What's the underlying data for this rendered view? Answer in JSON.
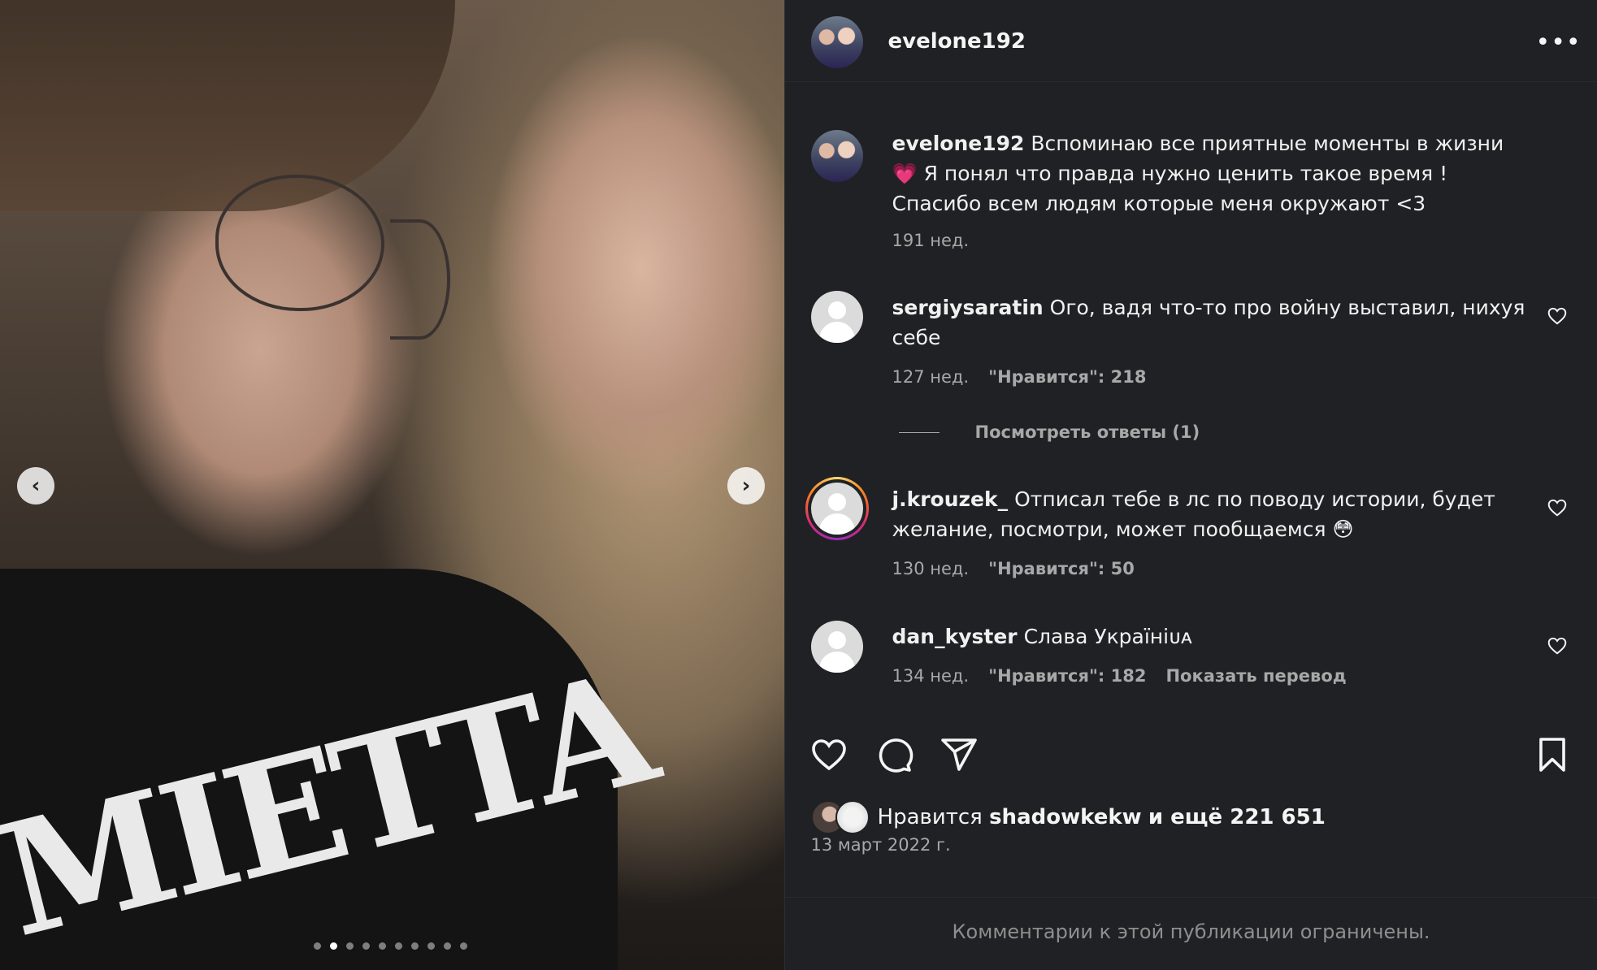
{
  "post": {
    "username": "evelone192",
    "caption": "Вспоминаю все приятные моменты в жизни 💗 Я понял что правда нужно ценить такое время ! Спасибо всем людям которые меня окружают <3",
    "caption_age": "191 нед."
  },
  "media": {
    "hoodie_text": "MIETTA",
    "carousel": {
      "total": 10,
      "current": 2
    },
    "prev_icon": "chevron-left-icon",
    "next_icon": "chevron-right-icon"
  },
  "comments": [
    {
      "username": "sergiysaratin",
      "text": "Ого, вадя что-то про войну выставил, нихуя себе",
      "age": "127 нед.",
      "likes": "\"Нравится\": 218"
    },
    {
      "username": "j.krouzek_",
      "text": "Отписал тебе в лс по поводу истории, будет желание, посмотри, может пообщаемся 😳",
      "age": "130 нед.",
      "likes": "\"Нравится\": 50"
    },
    {
      "username": "dan_kyster",
      "text": "Слава Україніᴜᴀ",
      "age": "134 нед.",
      "likes": "\"Нравится\": 182",
      "translate": "Показать перевод"
    }
  ],
  "view_replies": "Посмотреть ответы (1)",
  "likes_summary": {
    "prefix": "Нравится",
    "user": "shadowkekw",
    "suffix": "и ещё 221 651"
  },
  "date": "13 март 2022 г.",
  "comments_restricted": "Комментарии к этой публикации ограничены.",
  "colors": {
    "panel_bg": "#202124",
    "text_primary": "#f5f5f5",
    "text_secondary": "#a8a8a8",
    "story_ring": [
      "#feda75",
      "#fa7e1e",
      "#d62976",
      "#962fbf"
    ]
  }
}
